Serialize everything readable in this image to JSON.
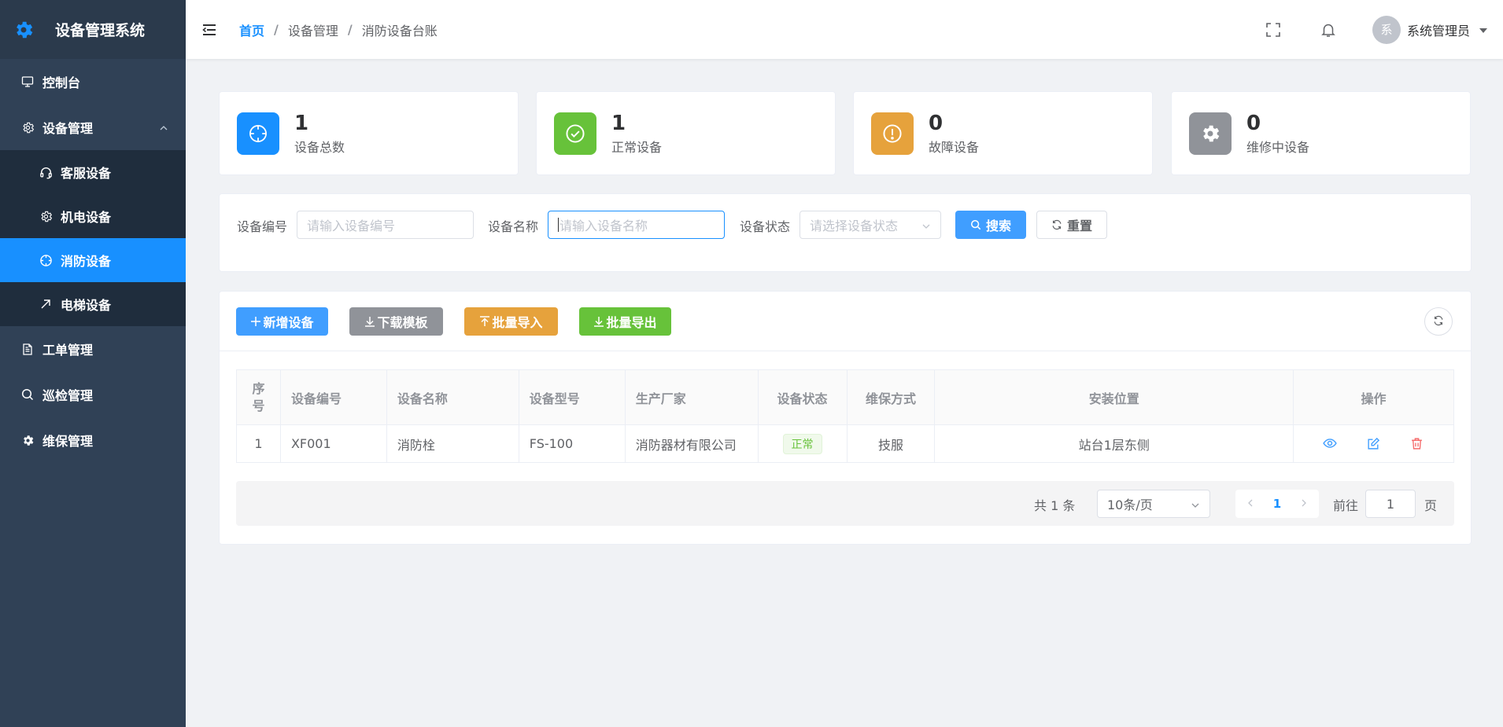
{
  "app": {
    "title": "设备管理系统"
  },
  "sidebar": {
    "items": [
      {
        "label": "控制台"
      },
      {
        "label": "设备管理"
      },
      {
        "label": "客服设备"
      },
      {
        "label": "机电设备"
      },
      {
        "label": "消防设备"
      },
      {
        "label": "电梯设备"
      },
      {
        "label": "工单管理"
      },
      {
        "label": "巡检管理"
      },
      {
        "label": "维保管理"
      }
    ]
  },
  "header": {
    "breadcrumb": [
      "首页",
      "设备管理",
      "消防设备台账"
    ],
    "separator": "/",
    "avatar_char": "系",
    "user_name": "系统管理员"
  },
  "stats": [
    {
      "value": "1",
      "label": "设备总数",
      "color": "#1890ff"
    },
    {
      "value": "1",
      "label": "正常设备",
      "color": "#67c23a"
    },
    {
      "value": "0",
      "label": "故障设备",
      "color": "#e6a23c"
    },
    {
      "value": "0",
      "label": "维修中设备",
      "color": "#909399"
    }
  ],
  "search": {
    "code_label": "设备编号",
    "code_placeholder": "请输入设备编号",
    "name_label": "设备名称",
    "name_placeholder": "请输入设备名称",
    "status_label": "设备状态",
    "status_placeholder": "请选择设备状态",
    "search_btn": "搜索",
    "reset_btn": "重置"
  },
  "toolbar": {
    "add": "新增设备",
    "download": "下载模板",
    "import": "批量导入",
    "export": "批量导出"
  },
  "table": {
    "headers": [
      "序号",
      "设备编号",
      "设备名称",
      "设备型号",
      "生产厂家",
      "设备状态",
      "维保方式",
      "安装位置",
      "操作"
    ],
    "rows": [
      {
        "index": "1",
        "code": "XF001",
        "name": "消防栓",
        "model": "FS-100",
        "maker": "消防器材有限公司",
        "status": "正常",
        "maint": "技服",
        "location": "站台1层东侧"
      }
    ]
  },
  "pagination": {
    "total": "共 1 条",
    "page_size": "10条/页",
    "current": "1",
    "goto_label": "前往",
    "goto_value": "1",
    "page_suffix": "页"
  },
  "colors": {
    "primary": "#1890ff",
    "sidebar_bg": "#304156",
    "success": "#67c23a",
    "warning": "#e6a23c",
    "info": "#909399",
    "danger": "#f56c6c"
  }
}
